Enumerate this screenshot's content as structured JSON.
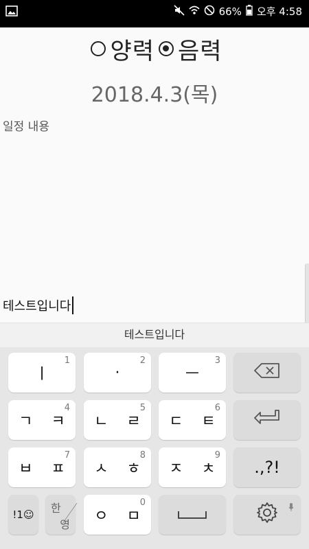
{
  "status_bar": {
    "battery": "66%",
    "time": "오후 4:58",
    "icons": [
      "gallery-icon",
      "mute-icon",
      "wifi-icon",
      "do-not-disturb-icon",
      "battery-icon"
    ]
  },
  "calendar_type": {
    "solar_label": "양력",
    "lunar_label": "음력",
    "selected": "lunar"
  },
  "date": "2018.4.3(목)",
  "memo": {
    "label": "일정 내용",
    "text": "테스트입니다"
  },
  "suggestion": "테스트입니다",
  "keyboard": {
    "row1": [
      {
        "label": "ㅣ",
        "num": "1"
      },
      {
        "label": "·",
        "num": "2"
      },
      {
        "label": "ㅡ",
        "num": "3"
      },
      {
        "label": "backspace-icon"
      }
    ],
    "row2": [
      {
        "label": "ㄱ ㅋ",
        "num": "4"
      },
      {
        "label": "ㄴ ㄹ",
        "num": "5"
      },
      {
        "label": "ㄷ ㅌ",
        "num": "6"
      },
      {
        "label": "enter-icon"
      }
    ],
    "row3": [
      {
        "label": "ㅂ ㅍ",
        "num": "7"
      },
      {
        "label": "ㅅ ㅎ",
        "num": "8"
      },
      {
        "label": "ㅈ ㅊ",
        "num": "9"
      },
      {
        "label": ".,?!"
      }
    ],
    "row4": {
      "symbols": "!1☺",
      "lang_han": "한",
      "lang_eng": "영",
      "zero_label": "ㅇ ㅁ",
      "zero_num": "0"
    }
  }
}
